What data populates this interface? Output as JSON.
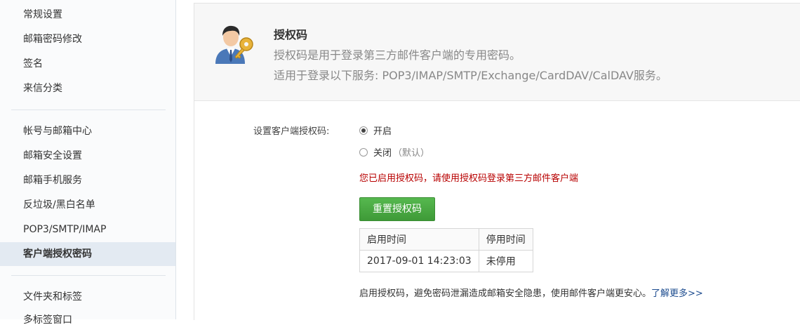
{
  "sidebar": {
    "items": [
      {
        "label": "常规设置"
      },
      {
        "label": "邮箱密码修改"
      },
      {
        "label": "签名"
      },
      {
        "label": "来信分类"
      },
      {
        "label": "帐号与邮箱中心"
      },
      {
        "label": "邮箱安全设置"
      },
      {
        "label": "邮箱手机服务"
      },
      {
        "label": "反垃圾/黑白名单"
      },
      {
        "label": "POP3/SMTP/IMAP"
      },
      {
        "label": "客户端授权密码"
      },
      {
        "label": "文件夹和标签"
      },
      {
        "label": "多标签窗口"
      }
    ],
    "active_label": "客户端授权密码"
  },
  "header": {
    "title": "授权码",
    "desc_line1": "授权码是用于登录第三方邮件客户端的专用密码。",
    "desc_line2": "适用于登录以下服务: POP3/IMAP/SMTP/Exchange/CardDAV/CalDAV服务。",
    "icon": "user-key-icon"
  },
  "settings": {
    "label": "设置客户端授权码:",
    "options": [
      {
        "label": "开启",
        "hint": "",
        "checked": true
      },
      {
        "label": "关闭",
        "hint": "（默认）",
        "checked": false
      }
    ],
    "notice": "您已启用授权码，请使用授权码登录第三方邮件客户端",
    "reset_button": "重置授权码"
  },
  "log_table": {
    "headers": [
      "启用时间",
      "停用时间"
    ],
    "rows": [
      [
        "2017-09-01 14:23:03",
        "未停用"
      ]
    ]
  },
  "footer": {
    "text": "启用授权码，避免密码泄漏造成邮箱安全隐患，使用邮件客户端更安心。",
    "link": "了解更多>>"
  },
  "colors": {
    "accent_green": "#4caf45",
    "notice_red": "#b80000",
    "link_blue": "#1d4c8f",
    "active_bg": "#e3eaf2"
  }
}
